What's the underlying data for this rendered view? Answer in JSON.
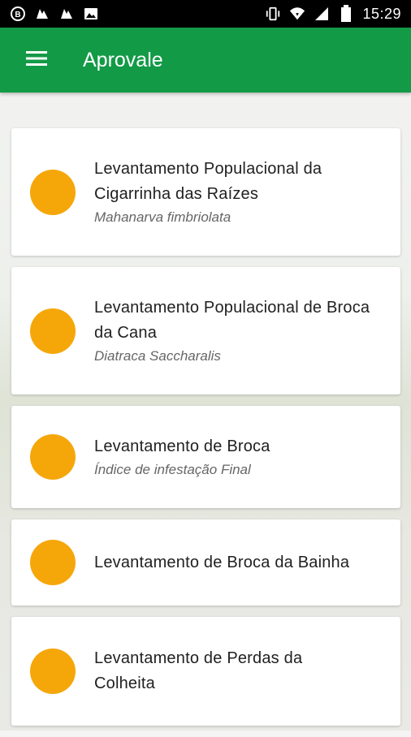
{
  "status_bar": {
    "time": "15:29",
    "icons": [
      "b-circle-icon",
      "notification-icon",
      "notification-icon",
      "image-icon",
      "vibrate-icon",
      "wifi-icon",
      "signal-icon",
      "battery-icon"
    ]
  },
  "app_bar": {
    "title": "Aprovale",
    "menu_icon": "hamburger-icon",
    "color": "#139a46"
  },
  "dot_color": "#f5a70a",
  "items": [
    {
      "title": "Levantamento Populacional da Cigarrinha das Raízes",
      "subtitle": "Mahanarva fimbriolata"
    },
    {
      "title": "Levantamento Populacional de Broca da Cana",
      "subtitle": "Diatraca Saccharalis"
    },
    {
      "title": "Levantamento de Broca",
      "subtitle": "Índice de infestação Final"
    },
    {
      "title": "Levantamento de Broca da Bainha",
      "subtitle": ""
    },
    {
      "title": "Levantamento de Perdas da Colheita",
      "subtitle": ""
    }
  ]
}
